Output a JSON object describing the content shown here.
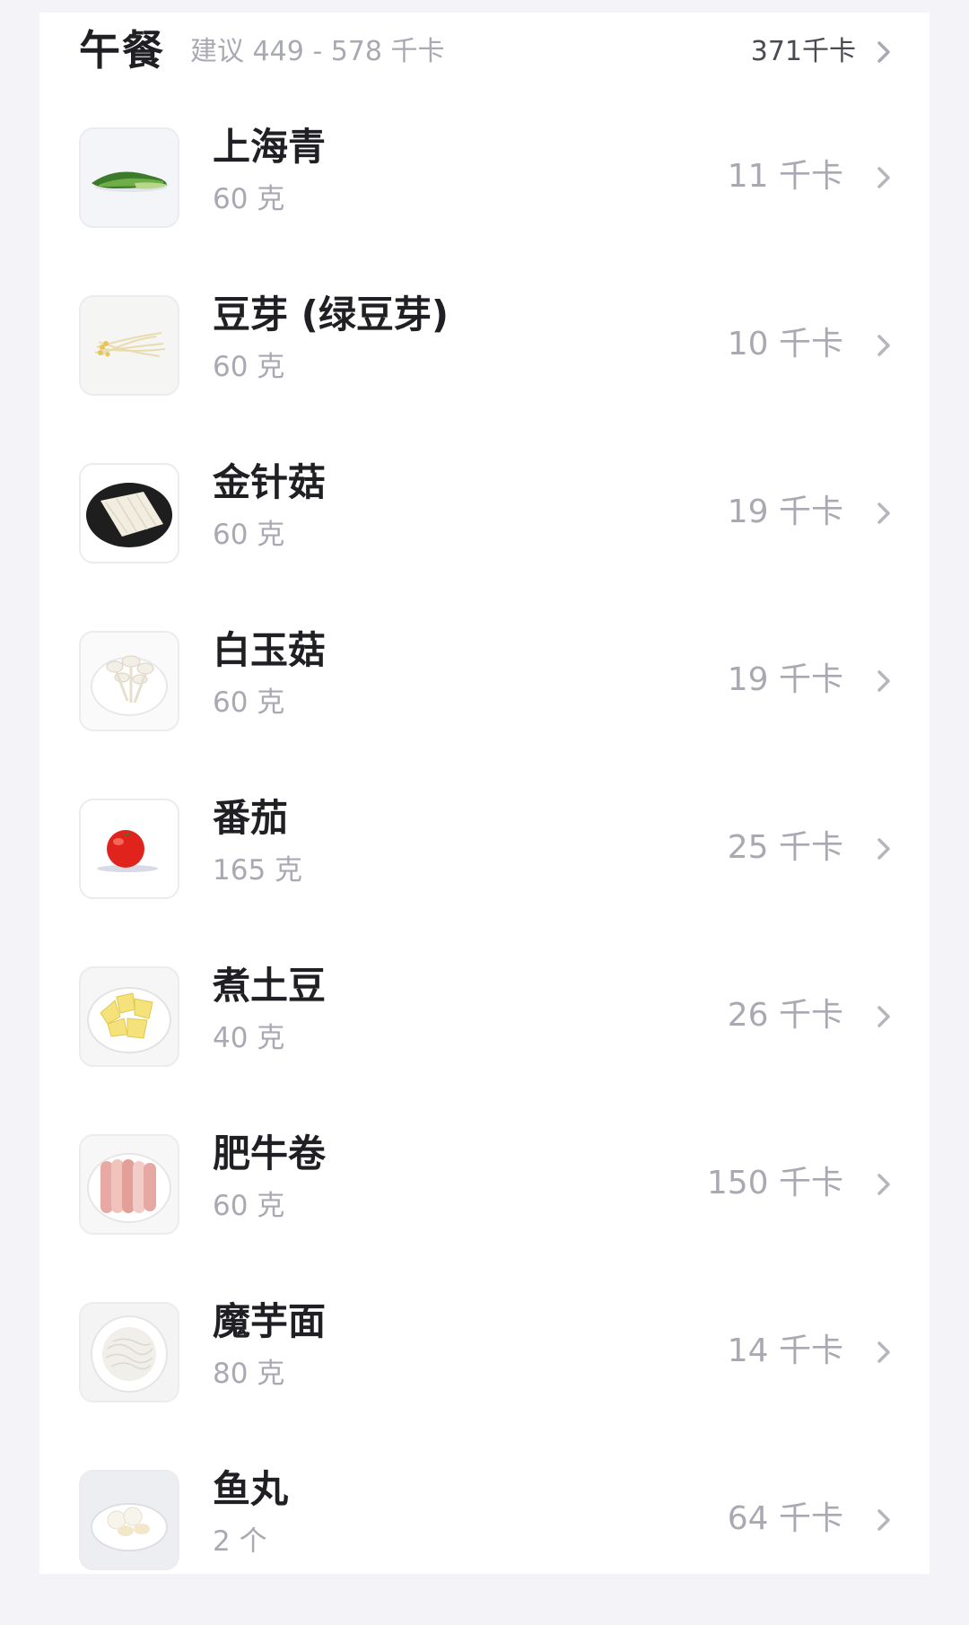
{
  "meal": {
    "title": "午餐",
    "suggestion": "建议 449 - 578 千卡",
    "total": "371千卡"
  },
  "items": [
    {
      "name": "上海青",
      "amount": "60 克",
      "kcal": "11 千卡",
      "icon": "bok-choy-photo"
    },
    {
      "name": "豆芽 (绿豆芽)",
      "amount": "60 克",
      "kcal": "10 千卡",
      "icon": "bean-sprouts-photo"
    },
    {
      "name": "金针菇",
      "amount": "60 克",
      "kcal": "19 千卡",
      "icon": "enoki-mushroom-photo"
    },
    {
      "name": "白玉菇",
      "amount": "60 克",
      "kcal": "19 千卡",
      "icon": "white-mushroom-photo"
    },
    {
      "name": "番茄",
      "amount": "165 克",
      "kcal": "25 千卡",
      "icon": "tomato-photo"
    },
    {
      "name": "煮土豆",
      "amount": "40 克",
      "kcal": "26 千卡",
      "icon": "boiled-potato-photo"
    },
    {
      "name": "肥牛卷",
      "amount": "60 克",
      "kcal": "150 千卡",
      "icon": "beef-roll-photo"
    },
    {
      "name": "魔芋面",
      "amount": "80 克",
      "kcal": "14 千卡",
      "icon": "konjac-noodle-photo"
    },
    {
      "name": "鱼丸",
      "amount": "2 个",
      "kcal": "64 千卡",
      "icon": "fish-ball-photo"
    }
  ],
  "colors": {
    "background": "#f4f4f8",
    "card": "#ffffff",
    "title": "#1f1f24",
    "muted": "#a9a9b3",
    "total": "#4a4a52"
  }
}
